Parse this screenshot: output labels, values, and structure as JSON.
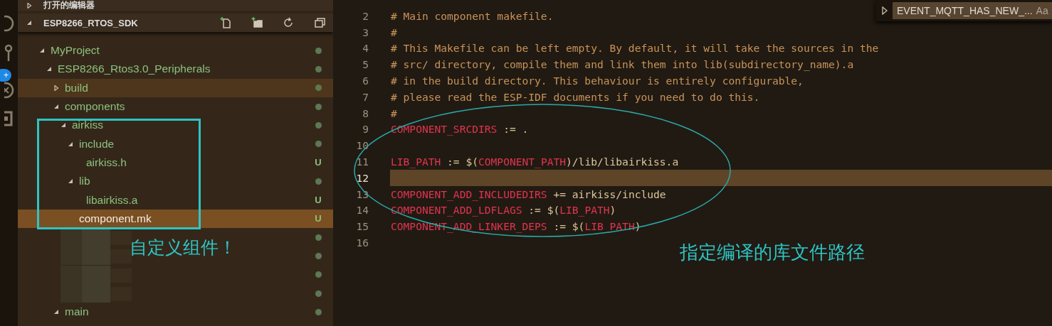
{
  "sidebar": {
    "sections": [
      {
        "title": "打开的编辑器",
        "expanded": false
      },
      {
        "title": "ESP8266_RTOS_SDK",
        "expanded": true
      }
    ],
    "tree": [
      {
        "name": "MyProject",
        "expanded": true,
        "selected": false,
        "hover": false,
        "dot": true,
        "children": [
          {
            "name": "ESP8266_Rtos3.0_Peripherals",
            "expanded": true,
            "selected": false,
            "hover": false,
            "dot": true,
            "children": [
              {
                "name": "build",
                "expanded": false,
                "selected": false,
                "hover": true,
                "dot": true
              },
              {
                "name": "components",
                "expanded": true,
                "selected": false,
                "hover": false,
                "dot": true,
                "children": [
                  {
                    "name": "airkiss",
                    "expanded": true,
                    "selected": false,
                    "hover": false,
                    "dot": true,
                    "children": [
                      {
                        "name": "include",
                        "expanded": true,
                        "selected": false,
                        "hover": false,
                        "dot": true,
                        "children": [
                          {
                            "name": "airkiss.h",
                            "selected": false,
                            "hover": false,
                            "badge": "U"
                          }
                        ]
                      },
                      {
                        "name": "lib",
                        "expanded": true,
                        "selected": false,
                        "hover": false,
                        "dot": true,
                        "children": [
                          {
                            "name": "libairkiss.a",
                            "selected": false,
                            "hover": false,
                            "badge": "U"
                          }
                        ]
                      },
                      {
                        "name": "component.mk",
                        "selected": true,
                        "hover": false,
                        "badge": "U"
                      }
                    ]
                  },
                  {
                    "kind": "redacted",
                    "dot": true
                  },
                  {
                    "kind": "redacted",
                    "dot": true
                  },
                  {
                    "kind": "redacted",
                    "dot": true
                  },
                  {
                    "kind": "redacted",
                    "dot": true
                  }
                ]
              },
              {
                "name": "main",
                "expanded": true,
                "selected": false,
                "hover": false,
                "dot": true
              }
            ]
          }
        ]
      }
    ]
  },
  "find_widget": {
    "query": "EVENT_MQTT_HAS_NEW_...",
    "match_case": "Aa"
  },
  "editor": {
    "lines": [
      {
        "n": "2",
        "highlight": false,
        "tokens": [
          {
            "t": "# Main component makefile.",
            "kind": "comment"
          }
        ]
      },
      {
        "n": "3",
        "highlight": false,
        "tokens": [
          {
            "t": "#",
            "kind": "comment"
          }
        ]
      },
      {
        "n": "4",
        "highlight": false,
        "tokens": [
          {
            "t": "# This Makefile can be left empty. By default, it will take the sources in the",
            "kind": "comment"
          }
        ]
      },
      {
        "n": "5",
        "highlight": false,
        "tokens": [
          {
            "t": "# src/ directory, compile them and link them into lib(subdirectory_name).a",
            "kind": "comment"
          }
        ]
      },
      {
        "n": "6",
        "highlight": false,
        "tokens": [
          {
            "t": "# in the build directory. This behaviour is entirely configurable,",
            "kind": "comment"
          }
        ]
      },
      {
        "n": "7",
        "highlight": false,
        "tokens": [
          {
            "t": "# please read the ESP-IDF documents if you need to do this.",
            "kind": "comment"
          }
        ]
      },
      {
        "n": "8",
        "highlight": false,
        "tokens": [
          {
            "t": "#",
            "kind": "comment"
          }
        ]
      },
      {
        "n": "9",
        "highlight": false,
        "tokens": [
          {
            "t": "COMPONENT_SRCDIRS",
            "kind": "var"
          },
          {
            "t": " := .",
            "kind": "plain"
          }
        ]
      },
      {
        "n": "10",
        "highlight": false
      },
      {
        "n": "11",
        "highlight": false,
        "tokens": [
          {
            "t": "LIB_PATH",
            "kind": "var"
          },
          {
            "t": " := $(",
            "kind": "plain"
          },
          {
            "t": "COMPONENT_PATH",
            "kind": "var"
          },
          {
            "t": ")/lib/libairkiss.a",
            "kind": "plain"
          }
        ]
      },
      {
        "n": "12",
        "highlight": true
      },
      {
        "n": "13",
        "highlight": false,
        "tokens": [
          {
            "t": "COMPONENT_ADD_INCLUDEDIRS",
            "kind": "var"
          },
          {
            "t": " += airkiss/include",
            "kind": "plain"
          }
        ]
      },
      {
        "n": "14",
        "highlight": false,
        "tokens": [
          {
            "t": "COMPONENT_ADD_LDFLAGS",
            "kind": "var"
          },
          {
            "t": " := $(",
            "kind": "plain"
          },
          {
            "t": "LIB_PATH",
            "kind": "var"
          },
          {
            "t": ")",
            "kind": "plain"
          }
        ]
      },
      {
        "n": "15",
        "highlight": false,
        "tokens": [
          {
            "t": "COMPONENT_ADD_LINKER_DEPS",
            "kind": "var"
          },
          {
            "t": " := $(",
            "kind": "plain"
          },
          {
            "t": "LIB_PATH",
            "kind": "var"
          },
          {
            "t": ")",
            "kind": "plain"
          }
        ]
      },
      {
        "n": "16",
        "highlight": false
      }
    ]
  },
  "activity_bar": {
    "badge": "+"
  },
  "annotations": [
    {
      "kind": "rect",
      "label": "自定义组件！"
    },
    {
      "kind": "ellipse",
      "label": "指定编译的库文件路径"
    }
  ]
}
